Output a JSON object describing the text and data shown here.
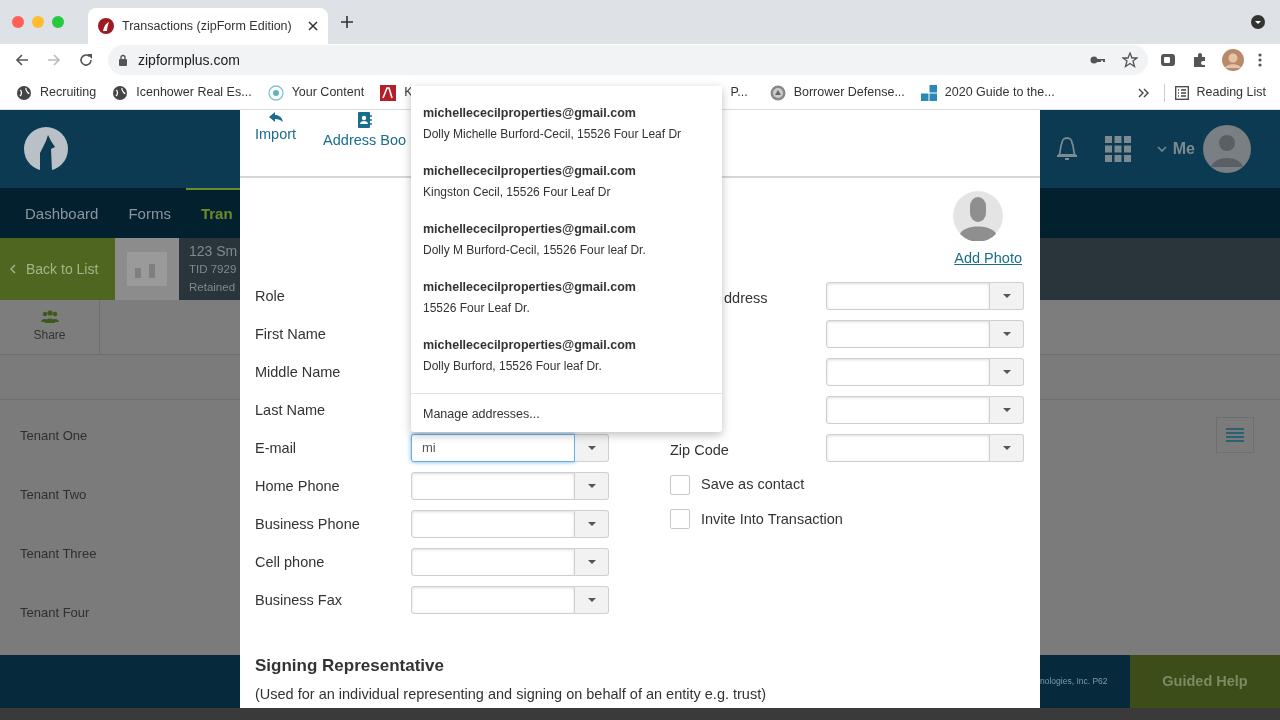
{
  "browser": {
    "tab_title": "Transactions (zipForm Edition)",
    "url": "zipformplus.com",
    "bookmarks": [
      {
        "label": "Recruiting",
        "kind": "globe"
      },
      {
        "label": "Icenhower Real Es...",
        "kind": "globe"
      },
      {
        "label": "Your Content",
        "kind": "target"
      },
      {
        "label": "K",
        "kind": "brand"
      },
      {
        "label": "P...",
        "kind": "none"
      },
      {
        "label": "Borrower Defense...",
        "kind": "seal"
      },
      {
        "label": "2020 Guide to the...",
        "kind": "fsld"
      }
    ],
    "reading_list": "Reading List"
  },
  "app": {
    "nav": [
      {
        "label": "Dashboard",
        "selected": false
      },
      {
        "label": "Forms",
        "selected": false
      },
      {
        "label": "Tran",
        "selected": true
      }
    ],
    "user_menu": "Me",
    "back_button": "Back to List",
    "property": {
      "address": "123 Sm",
      "tid": "TID 7929",
      "status": "Retained"
    },
    "share": "Share",
    "tenants": [
      "Tenant One",
      "Tenant Two",
      "Tenant Three",
      "Tenant Four"
    ],
    "footer_text": "nologies, Inc. P62",
    "guided_help": "Guided Help"
  },
  "dialog": {
    "toolbar": [
      {
        "label": "Import",
        "kind": "reply"
      },
      {
        "label": "Address Boo",
        "kind": "book"
      }
    ],
    "add_photo": "Add Photo",
    "left_fields": [
      {
        "label": "Role",
        "kind": "covered"
      },
      {
        "label": "First Name",
        "kind": "covered"
      },
      {
        "label": "Middle Name",
        "kind": "covered"
      },
      {
        "label": "Last Name",
        "kind": "covered"
      },
      {
        "label": "E-mail",
        "kind": "field",
        "value": "mi",
        "focused": true
      },
      {
        "label": "Home Phone",
        "kind": "field",
        "focused": false
      },
      {
        "label": "Business Phone",
        "kind": "field",
        "focused": false
      },
      {
        "label": "Cell phone",
        "kind": "field",
        "focused": false
      },
      {
        "label": "Business Fax",
        "kind": "field",
        "focused": false
      }
    ],
    "right_fields": [
      {
        "label": "ddress",
        "kind": "cut_label"
      },
      {
        "kind": "field"
      },
      {
        "kind": "field"
      },
      {
        "kind": "field"
      },
      {
        "label": "Zip Code",
        "kind": "field"
      }
    ],
    "checkboxes": [
      {
        "label": "Save as contact",
        "checked": false
      },
      {
        "label": "Invite Into Transaction",
        "checked": false
      }
    ],
    "section_title": "Signing Representative",
    "section_note": "(Used for an individual representing and signing on behalf of an entity e.g. trust)"
  },
  "suggestions": {
    "items": [
      {
        "email": "michellececilproperties@gmail.com",
        "detail": "Dolly Michelle Burford-Cecil, 15526 Four Leaf Dr"
      },
      {
        "email": "michellececilproperties@gmail.com",
        "detail": "Kingston Cecil, 15526 Four Leaf Dr"
      },
      {
        "email": "michellececilproperties@gmail.com",
        "detail": "Dolly M Burford-Cecil, 15526 Four leaf Dr."
      },
      {
        "email": "michellececilproperties@gmail.com",
        "detail": "15526 Four Leaf Dr."
      },
      {
        "email": "michellececilproperties@gmail.com",
        "detail": "Dolly Burford, 15526 Four leaf Dr."
      }
    ],
    "manage": "Manage addresses..."
  }
}
